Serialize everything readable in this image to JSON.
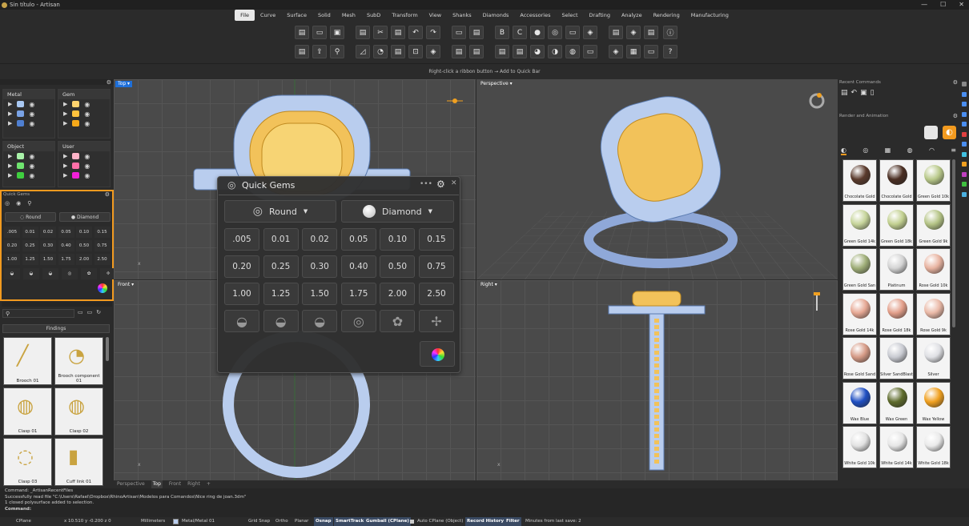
{
  "window": {
    "title": "Sin título - Artisan",
    "controls": [
      "—",
      "☐",
      "✕"
    ]
  },
  "menu": [
    "File",
    "Curve",
    "Surface",
    "Solid",
    "Mesh",
    "SubD",
    "Transform",
    "View",
    "Shanks",
    "Diamonds",
    "Accessories",
    "Select",
    "Drafting",
    "Analyze",
    "Rendering",
    "Manufacturing"
  ],
  "menu_active": "File",
  "quickbar_hint": "Right-click a ribbon button → Add to Quick Bar",
  "layers": {
    "metal": {
      "title": "Metal",
      "colors": [
        "#a9c8f2",
        "#7aa3e6",
        "#4f7fd1"
      ]
    },
    "gem": {
      "title": "Gem",
      "colors": [
        "#ffd36e",
        "#ffc23d",
        "#f6a919"
      ]
    },
    "object": {
      "title": "Object",
      "colors": [
        "#a9f2a9",
        "#6fe36f",
        "#3fce3f"
      ]
    },
    "user": {
      "title": "User",
      "colors": [
        "#ffb3c8",
        "#ff6fa8",
        "#f21fd8"
      ]
    }
  },
  "quick_gems_small": {
    "title": "Quick Gems",
    "cut": "Round",
    "material": "Diamond",
    "sizes": [
      ".005",
      "0.01",
      "0.02",
      "0.05",
      "0.10",
      "0.15",
      "0.20",
      "0.25",
      "0.30",
      "0.40",
      "0.50",
      "0.75",
      "1.00",
      "1.25",
      "1.50",
      "1.75",
      "2.00",
      "2.50"
    ]
  },
  "findings": {
    "category": "Findings",
    "items": [
      "Brooch 01",
      "Brooch component 01",
      "Clasp 01",
      "Clasp 02",
      "Clasp 03",
      "Cuff link 01"
    ]
  },
  "viewports": {
    "top": "Top",
    "perspective": "Perspective",
    "front": "Front",
    "right": "Right"
  },
  "viewport_tabs": [
    "Perspective",
    "Top",
    "Front",
    "Right",
    "+"
  ],
  "viewport_tab_active": "Top",
  "quick_gems": {
    "title": "Quick Gems",
    "cut": "Round",
    "material": "Diamond",
    "sizes": [
      ".005",
      "0.01",
      "0.02",
      "0.05",
      "0.10",
      "0.15",
      "0.20",
      "0.25",
      "0.30",
      "0.40",
      "0.50",
      "0.75",
      "1.00",
      "1.25",
      "1.50",
      "1.75",
      "2.00",
      "2.50"
    ]
  },
  "right_panel": {
    "recent_commands": "Recent Commands",
    "render_title": "Render and Animation",
    "materials": [
      {
        "name": "Chocolate Gold",
        "color": "#5a3a2c"
      },
      {
        "name": "Chocolate Gold",
        "color": "#4a2e22"
      },
      {
        "name": "Green Gold 10k",
        "color": "#b9c98a"
      },
      {
        "name": "Green Gold 14k",
        "color": "#c6d49a"
      },
      {
        "name": "Green Gold 18k",
        "color": "#c2d090"
      },
      {
        "name": "Green Gold 9k",
        "color": "#b5c486"
      },
      {
        "name": "Green Gold San",
        "color": "#9fae78"
      },
      {
        "name": "Platinum",
        "color": "#d4d4d4"
      },
      {
        "name": "Rose Gold 10k",
        "color": "#e8b3a0"
      },
      {
        "name": "Rose Gold 14k",
        "color": "#e6a894"
      },
      {
        "name": "Rose Gold 18k",
        "color": "#e29e89"
      },
      {
        "name": "Rose Gold 9k",
        "color": "#eab9a7"
      },
      {
        "name": "Rose Gold Sand",
        "color": "#d59a86"
      },
      {
        "name": "Silver SandBlast",
        "color": "#c9cbd2"
      },
      {
        "name": "Silver",
        "color": "#dfe0e4"
      },
      {
        "name": "Wax Blue",
        "color": "#1f4fc2"
      },
      {
        "name": "Wax Green",
        "color": "#5e6b2c"
      },
      {
        "name": "Wax Yellow",
        "color": "#f0a020"
      },
      {
        "name": "White Gold 10k",
        "color": "#e2e2e2"
      },
      {
        "name": "White Gold 14k",
        "color": "#e6e6e6"
      },
      {
        "name": "White Gold 18k",
        "color": "#eaeaea"
      }
    ]
  },
  "command_history": [
    "Command: _ArtisanRecentFiles",
    "Successfully read file \"C:\\Users\\Rafael\\Dropbox\\RhinoArtisan\\Modelos para Comandos\\Nice ring de joan.3dm\"",
    "1 closed polysurface added to selection."
  ],
  "command_prompt": "Command:",
  "status": {
    "cplane": "CPlane",
    "coords": "x 10.510  y -0.200  z 0",
    "units": "Millimeters",
    "layer": "Metal/Metal 01",
    "grid_snap": "Grid Snap",
    "ortho": "Ortho",
    "planar": "Planar",
    "osnap": "Osnap",
    "smarttrack": "SmartTrack",
    "gumball": "Gumball (CPlane)",
    "auto_cplane": "Auto CPlane (Object)",
    "record_history": "Record History",
    "filter": "Filter",
    "last_save": "Minutes from last save: 2"
  }
}
